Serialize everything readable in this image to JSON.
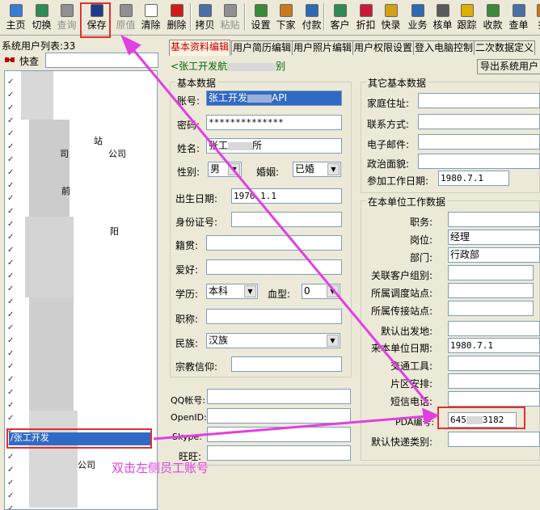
{
  "toolbar": {
    "buttons": [
      {
        "label": "主页",
        "color": "#3a7bd5"
      },
      {
        "label": "切换",
        "color": "#2e8b57"
      },
      {
        "label": "查询",
        "color": "#909090"
      },
      {
        "label": "保存",
        "color": "#1e3a8a"
      },
      {
        "label": "原值",
        "color": "#909090"
      },
      {
        "label": "清除",
        "color": "#ffffff"
      },
      {
        "label": "删除",
        "color": "#d11a1a"
      },
      {
        "label": "拷贝",
        "color": "#4a6fa5"
      },
      {
        "label": "粘贴",
        "color": "#909090"
      },
      {
        "label": "设置",
        "color": "#3a8a3a"
      },
      {
        "label": "下家",
        "color": "#c97a1a"
      },
      {
        "label": "付款",
        "color": "#2e6ab1"
      },
      {
        "label": "客户",
        "color": "#2e8b57"
      },
      {
        "label": "折扣",
        "color": "#c91a3a"
      },
      {
        "label": "快录",
        "color": "#d4a017"
      },
      {
        "label": "业务",
        "color": "#2e6ab1"
      },
      {
        "label": "核单",
        "color": "#5a5a5a"
      },
      {
        "label": "跟踪",
        "color": "#e0b000"
      },
      {
        "label": "收款",
        "color": "#3a8a3a"
      },
      {
        "label": "查单",
        "color": "#4a6fa5"
      },
      {
        "label": "打",
        "color": "#c97a1a"
      }
    ]
  },
  "left": {
    "title": "系统用户列表:33",
    "search_label": "快查",
    "items": [
      "站",
      "司",
      "公司",
      "前",
      "阳",
      "/张工开发",
      "公司"
    ]
  },
  "tabs": [
    "基本资料编辑",
    "用户简历编辑",
    "用户照片编辑",
    "用户权限设置",
    "登入电脑控制",
    "二次数据定义"
  ],
  "sub": {
    "user_label": "张工开发航",
    "other": "别",
    "export_button": "导出系统用户"
  },
  "basic": {
    "title": "基本数据",
    "account_label": "账号:",
    "account_value": "张工开发",
    "account_suffix": "API",
    "password_label": "密码:",
    "password_value": "**************",
    "name_label": "姓名:",
    "name_value": "张工",
    "name_mid": "所",
    "gender_label": "性别:",
    "gender_value": "男",
    "marriage_label": "婚姻:",
    "marriage_value": "已婚",
    "birth_label": "出生日期:",
    "birth_value": "1970.1.1",
    "id_label": "身份证号:",
    "native_label": "籍贯:",
    "hobby_label": "爱好:",
    "edu_label": "学历:",
    "edu_value": "本科",
    "blood_label": "血型:",
    "blood_value": "0",
    "title_label": "职称:",
    "ethnic_label": "民族:",
    "ethnic_value": "汉族",
    "religion_label": "宗教信仰:"
  },
  "other_basic": {
    "title": "其它基本数据",
    "address_label": "家庭住址:",
    "contact_label": "联系方式:",
    "email_label": "电子邮件:",
    "politics_label": "政治面貌:",
    "work_date_label": "参加工作日期:",
    "work_date_value": "1980.7.1"
  },
  "unit": {
    "title": "在本单位工作数据",
    "duty_label": "职务:",
    "post_label": "岗位:",
    "post_value": "经理",
    "dept_label": "部门:",
    "dept_value": "行政部",
    "customer_group_label": "关联客户组别:",
    "dispatch_label": "所属调度站点:",
    "transfer_label": "所属传接站点:",
    "default_depart_label": "默认出发地:",
    "join_date_label": "来本单位日期:",
    "join_date_value": "1980.7.1",
    "transport_label": "交通工具:",
    "area_label": "片区安排:",
    "sms_label": "短信电话:",
    "pda_label": "PDA编号:",
    "pda_value": "645",
    "pda_suffix": "3182",
    "courier_label": "默认快递类别:"
  },
  "contacts": {
    "qq_label": "QQ帐号:",
    "openid_label": "OpenID:",
    "skype_label": "Skype:",
    "wangwang_label": "旺旺:"
  },
  "annotation": {
    "text": "双击左侧员工账号",
    "color": "#e040e0"
  }
}
